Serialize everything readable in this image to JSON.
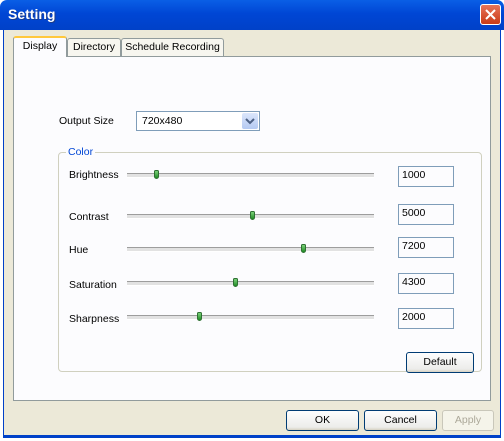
{
  "window": {
    "title": "Setting"
  },
  "tabs": [
    {
      "label": "Display"
    },
    {
      "label": "Directory"
    },
    {
      "label": "Schedule Recording"
    }
  ],
  "output_size": {
    "label": "Output Size",
    "value": "720x480"
  },
  "color_group": {
    "title": "Color",
    "sliders": [
      {
        "label": "Brightness",
        "value": "1000",
        "level": 0.11
      },
      {
        "label": "Contrast",
        "value": "5000",
        "level": 0.51
      },
      {
        "label": "Hue",
        "value": "7200",
        "level": 0.72
      },
      {
        "label": "Saturation",
        "value": "4300",
        "level": 0.44
      },
      {
        "label": "Sharpness",
        "value": "2000",
        "level": 0.29
      }
    ]
  },
  "buttons": {
    "default": "Default",
    "ok": "OK",
    "cancel": "Cancel",
    "apply": "Apply"
  },
  "colors": {
    "titlebar": "#0046d5",
    "client": "#ece9d8",
    "tab_highlight": "#ffc83c",
    "slider_thumb": "#1f8b24",
    "group_title": "#0046d5"
  }
}
